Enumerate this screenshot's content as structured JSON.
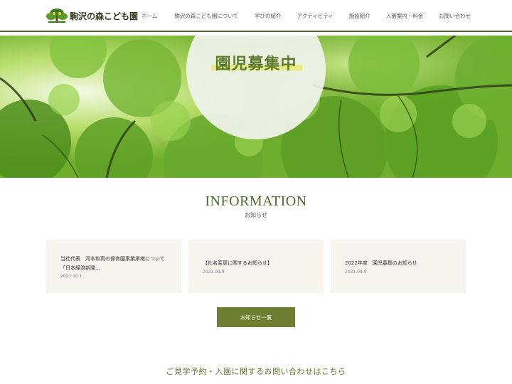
{
  "header": {
    "logo_text": "駒沢の森こども園",
    "nav": [
      {
        "label": "ホーム"
      },
      {
        "label": "駒沢の森こども園について"
      },
      {
        "label": "学びの紹介"
      },
      {
        "label": "アクティビティ"
      },
      {
        "label": "施設紹介"
      },
      {
        "label": "入園案内・料金"
      },
      {
        "label": "お問い合わせ"
      }
    ]
  },
  "hero": {
    "badge_text": "園児募集中"
  },
  "information": {
    "title": "INFORMATION",
    "subtitle": "お知らせ",
    "items": [
      {
        "title_line1": "当社代表　河本和真の保育園事業承継について",
        "title_line2": "「日本経済新聞...",
        "date": "2021.10.1"
      },
      {
        "title_line1": "【社名変更に関するお知らせ】",
        "title_line2": "",
        "date": "2021.09.9"
      },
      {
        "title_line1": "2022年度　園児募集のお知らせ",
        "title_line2": "",
        "date": "2021.09.9"
      }
    ],
    "more_label": "お知らせ一覧"
  },
  "contact": {
    "heading": "ご見学予約・入園に関するお問い合わせはこちら"
  },
  "colors": {
    "brand_green": "#4f6b2a",
    "button_olive": "#6e7f31",
    "card_bg": "#f7f4ee",
    "highlight_yellow": "#e9ec77"
  }
}
